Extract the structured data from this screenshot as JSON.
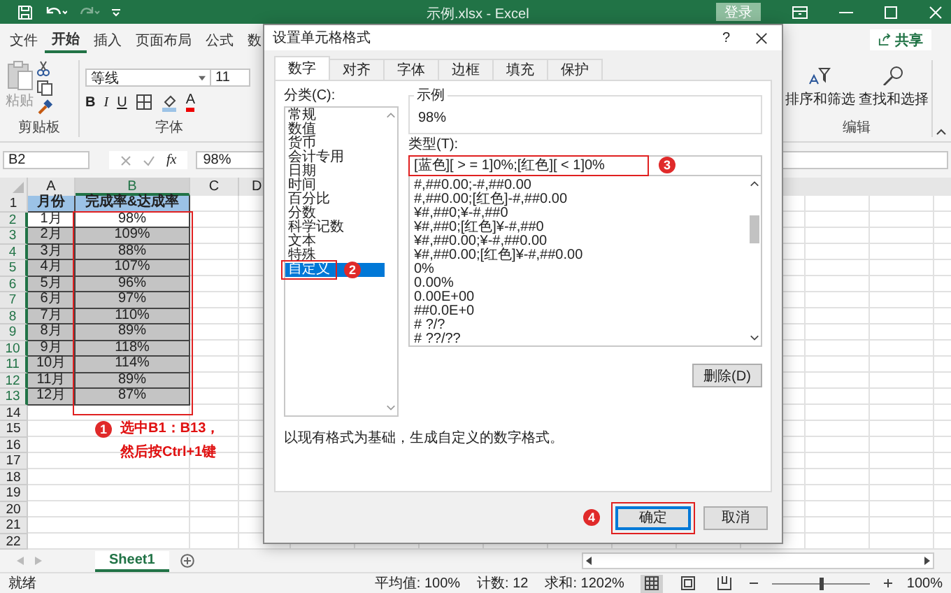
{
  "window": {
    "title": "示例.xlsx  -  Excel",
    "login_button": "登录"
  },
  "ribbon_tabs": [
    {
      "label": "文件",
      "selected": false
    },
    {
      "label": "开始",
      "selected": true
    },
    {
      "label": "插入",
      "selected": false
    },
    {
      "label": "页面布局",
      "selected": false
    },
    {
      "label": "公式",
      "selected": false
    },
    {
      "label": "数",
      "selected": false
    }
  ],
  "share_button": "共享",
  "ribbon": {
    "clipboard": {
      "paste": "粘贴",
      "label": "剪贴板"
    },
    "font": {
      "name": "等线",
      "size": "11",
      "format_buttons": [
        "B",
        "I",
        "U"
      ],
      "font_color": "A",
      "label": "字体"
    },
    "editing": {
      "sort": "排序和筛选",
      "find": "查找和选择",
      "label": "编辑"
    }
  },
  "formula_bar": {
    "name_box": "B2",
    "function_label": "fx",
    "value": "98%"
  },
  "sheet": {
    "columns": [
      {
        "label": "A",
        "selected": false
      },
      {
        "label": "B",
        "selected": true
      },
      {
        "label": "C",
        "selected": false
      },
      {
        "label": "D",
        "selected": false
      }
    ],
    "row_numbers": [
      {
        "label": "1",
        "selected": false
      },
      {
        "label": "2",
        "selected": true
      },
      {
        "label": "3",
        "selected": true
      },
      {
        "label": "4",
        "selected": true
      },
      {
        "label": "5",
        "selected": true
      },
      {
        "label": "6",
        "selected": true
      },
      {
        "label": "7",
        "selected": true
      },
      {
        "label": "8",
        "selected": true
      },
      {
        "label": "9",
        "selected": true
      },
      {
        "label": "10",
        "selected": true
      },
      {
        "label": "11",
        "selected": true
      },
      {
        "label": "12",
        "selected": true
      },
      {
        "label": "13",
        "selected": true
      },
      {
        "label": "14",
        "selected": false
      },
      {
        "label": "15",
        "selected": false
      },
      {
        "label": "16",
        "selected": false
      },
      {
        "label": "17",
        "selected": false
      },
      {
        "label": "18",
        "selected": false
      },
      {
        "label": "19",
        "selected": false
      },
      {
        "label": "20",
        "selected": false
      },
      {
        "label": "21",
        "selected": false
      },
      {
        "label": "22",
        "selected": false
      }
    ],
    "rows": [
      {
        "month": "月份",
        "rate": "完成率&达成率",
        "kind": "header"
      },
      {
        "month": "1月",
        "rate": "98%",
        "kind": "active"
      },
      {
        "month": "2月",
        "rate": "109%",
        "kind": "selected"
      },
      {
        "month": "3月",
        "rate": "88%",
        "kind": "selected"
      },
      {
        "month": "4月",
        "rate": "107%",
        "kind": "selected"
      },
      {
        "month": "5月",
        "rate": "96%",
        "kind": "selected"
      },
      {
        "month": "6月",
        "rate": "97%",
        "kind": "selected"
      },
      {
        "month": "7月",
        "rate": "110%",
        "kind": "selected"
      },
      {
        "month": "8月",
        "rate": "89%",
        "kind": "selected"
      },
      {
        "month": "9月",
        "rate": "118%",
        "kind": "selected"
      },
      {
        "month": "10月",
        "rate": "114%",
        "kind": "selected"
      },
      {
        "month": "11月",
        "rate": "89%",
        "kind": "selected"
      },
      {
        "month": "12月",
        "rate": "87%",
        "kind": "selected"
      }
    ],
    "annotation": {
      "badge": "1",
      "lines": [
        "选中B1：B13，",
        "然后按Ctrl+1键"
      ]
    }
  },
  "dialog": {
    "title": "设置单元格格式",
    "help": "?",
    "tabs": [
      {
        "label": "数字",
        "selected": true
      },
      {
        "label": "对齐",
        "selected": false
      },
      {
        "label": "字体",
        "selected": false
      },
      {
        "label": "边框",
        "selected": false
      },
      {
        "label": "填充",
        "selected": false
      },
      {
        "label": "保护",
        "selected": false
      }
    ],
    "category_label": "分类(C):",
    "categories": [
      {
        "label": "常规",
        "selected": false
      },
      {
        "label": "数值",
        "selected": false
      },
      {
        "label": "货币",
        "selected": false
      },
      {
        "label": "会计专用",
        "selected": false
      },
      {
        "label": "日期",
        "selected": false
      },
      {
        "label": "时间",
        "selected": false
      },
      {
        "label": "百分比",
        "selected": false
      },
      {
        "label": "分数",
        "selected": false
      },
      {
        "label": "科学记数",
        "selected": false
      },
      {
        "label": "文本",
        "selected": false
      },
      {
        "label": "特殊",
        "selected": false
      },
      {
        "label": "自定义",
        "selected": true
      }
    ],
    "category_badge": "2",
    "sample_label": "示例",
    "sample_value": "98%",
    "type_label": "类型(T):",
    "type_value": "[蓝色][ > = 1]0%;[红色][ < 1]0%",
    "type_badge": "3",
    "formats": [
      "#,##0.00;-#,##0.00",
      "#,##0.00;[红色]-#,##0.00",
      "¥#,##0;¥-#,##0",
      "¥#,##0;[红色]¥-#,##0",
      "¥#,##0.00;¥-#,##0.00",
      "¥#,##0.00;[红色]¥-#,##0.00",
      "0%",
      "0.00%",
      "0.00E+00",
      "##0.0E+0",
      "# ?/?",
      "# ??/??"
    ],
    "delete_button": "删除(D)",
    "description": "以现有格式为基础，生成自定义的数字格式。",
    "ok_button": "确定",
    "ok_badge": "4",
    "cancel_button": "取消"
  },
  "sheet_tabs": [
    {
      "label": "Sheet1",
      "selected": true
    }
  ],
  "status_bar": {
    "status": "就绪",
    "average": "平均值: 100%",
    "count": "计数: 12",
    "sum": "求和: 1202%",
    "views": [
      {
        "kind": "normal",
        "selected": true
      },
      {
        "kind": "layout",
        "selected": false
      },
      {
        "kind": "pagebreak",
        "selected": false
      }
    ],
    "zoom_slider": {
      "level": 0.5
    },
    "zoom": "100%"
  }
}
